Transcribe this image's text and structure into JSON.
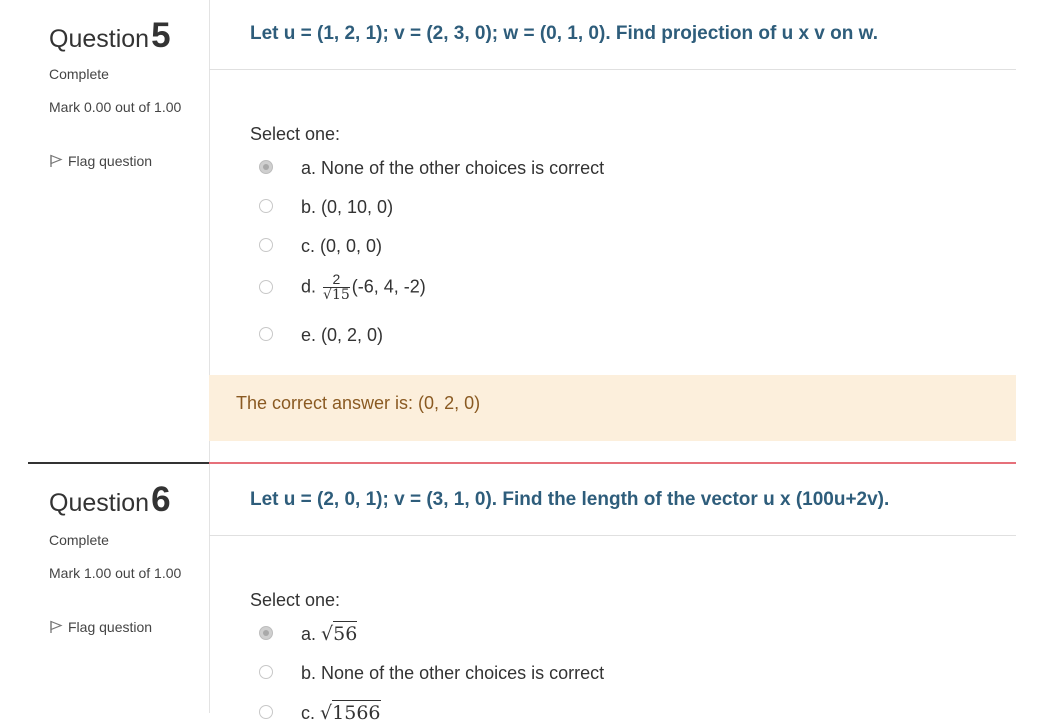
{
  "question5": {
    "label": "Question",
    "number": "5",
    "state": "Complete",
    "grade": "Mark 0.00 out of 1.00",
    "flag_label": "Flag question",
    "text": "Let u = (1, 2, 1); v = (2, 3, 0); w = (0, 1, 0). Find projection of u x v on w.",
    "prompt": "Select one:",
    "options": [
      {
        "prefix": "a.",
        "text": "None of the other choices is correct",
        "selected": true
      },
      {
        "prefix": "b.",
        "text": "(0, 10, 0)",
        "selected": false
      },
      {
        "prefix": "c.",
        "text": "(0, 0, 0)",
        "selected": false
      },
      {
        "prefix": "d.",
        "frac_num": "2",
        "frac_den": "√15",
        "text": "(-6, 4, -2)",
        "selected": false
      },
      {
        "prefix": "e.",
        "text": "(0, 2, 0)",
        "selected": false
      }
    ],
    "feedback": "The correct answer is: (0, 2, 0)"
  },
  "question6": {
    "label": "Question",
    "number": "6",
    "state": "Complete",
    "grade": "Mark 1.00 out of 1.00",
    "flag_label": "Flag question",
    "text": "Let u = (2, 0, 1); v = (3, 1, 0). Find the length of the vector u x (100u+2v).",
    "prompt": "Select one:",
    "options": [
      {
        "prefix": "a.",
        "radical": "√",
        "radicand": "56",
        "selected": true
      },
      {
        "prefix": "b.",
        "text": "None of the other choices is correct",
        "selected": false
      },
      {
        "prefix": "c.",
        "radical": "√",
        "radicand": "1566",
        "selected": false
      }
    ]
  },
  "colors": {
    "question_text": "#2e5d7b",
    "feedback_bg": "#fcefdc",
    "feedback_text": "#8a5a22",
    "divider_accent": "#e6707a"
  }
}
